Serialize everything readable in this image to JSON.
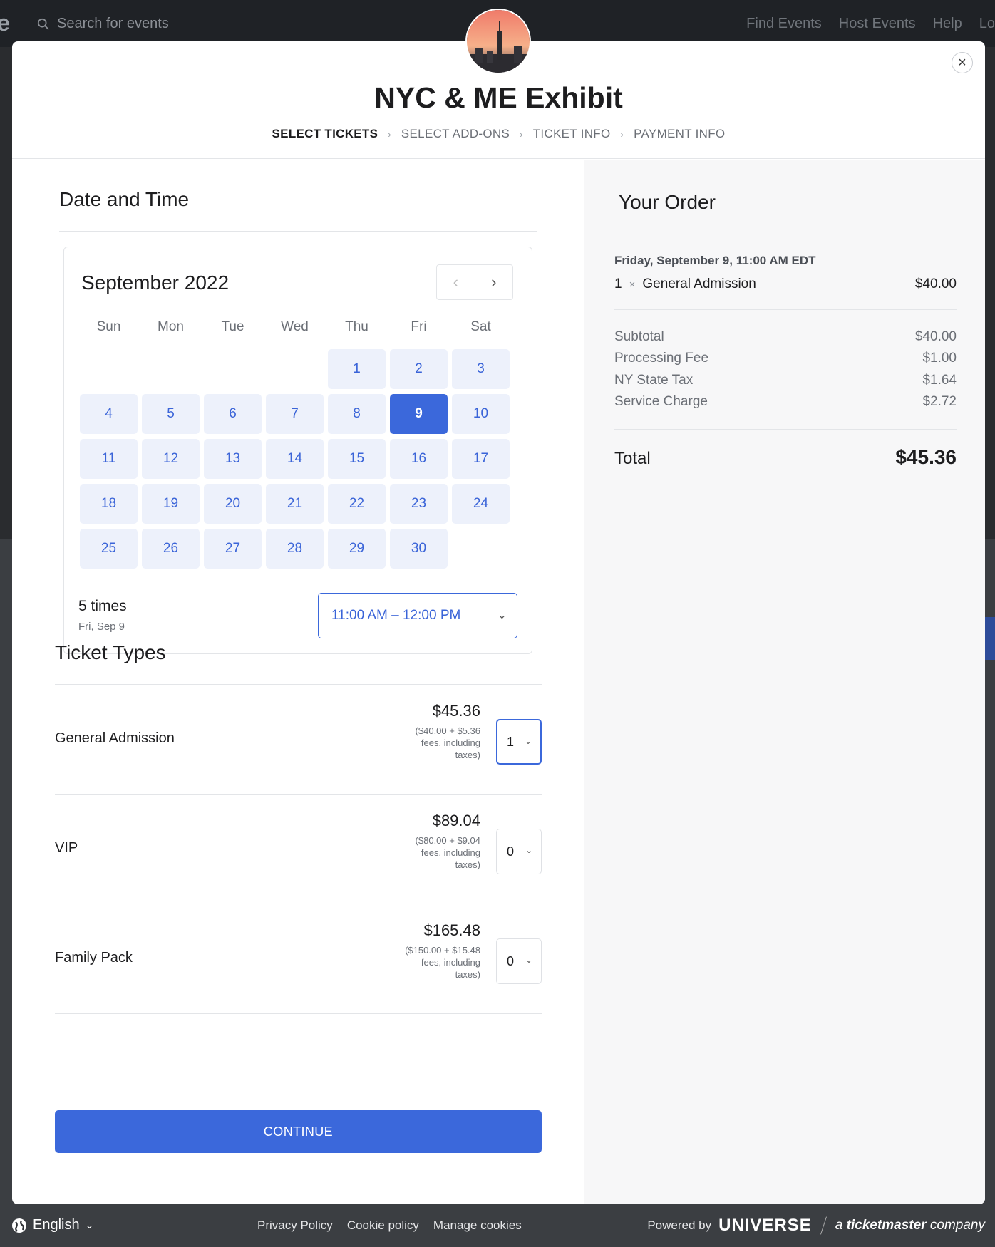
{
  "background": {
    "search_placeholder": "Search for events",
    "nav": [
      "Find Events",
      "Host Events",
      "Help",
      "Lo"
    ]
  },
  "modal": {
    "title": "NYC & ME Exhibit",
    "close_glyph": "×",
    "steps": [
      {
        "label": "SELECT TICKETS",
        "active": true
      },
      {
        "label": "SELECT ADD-ONS",
        "active": false
      },
      {
        "label": "TICKET INFO",
        "active": false
      },
      {
        "label": "PAYMENT INFO",
        "active": false
      }
    ]
  },
  "date_time": {
    "title": "Date and Time",
    "month": "September 2022",
    "prev_glyph": "‹",
    "next_glyph": "›",
    "weekdays": [
      "Sun",
      "Mon",
      "Tue",
      "Wed",
      "Thu",
      "Fri",
      "Sat"
    ],
    "first_weekday_index": 4,
    "days_in_month": 30,
    "selected_day": 9,
    "times_count": "5 times",
    "times_date": "Fri, Sep 9",
    "time_selected": "11:00 AM – 12:00 PM"
  },
  "tickets": {
    "title": "Ticket Types",
    "items": [
      {
        "name": "General Admission",
        "price": "$45.36",
        "fee": "($40.00 + $5.36 fees, including taxes)",
        "qty": "1"
      },
      {
        "name": "VIP",
        "price": "$89.04",
        "fee": "($80.00 + $9.04 fees, including taxes)",
        "qty": "0"
      },
      {
        "name": "Family Pack",
        "price": "$165.48",
        "fee": "($150.00 + $15.48 fees, including taxes)",
        "qty": "0"
      }
    ],
    "continue_label": "CONTINUE"
  },
  "order": {
    "title": "Your Order",
    "date": "Friday, September 9, 11:00 AM EDT",
    "line_qty": "1",
    "line_x": "×",
    "line_name": "General Admission",
    "line_price": "$40.00",
    "fees": [
      {
        "label": "Subtotal",
        "value": "$40.00"
      },
      {
        "label": "Processing Fee",
        "value": "$1.00"
      },
      {
        "label": "NY State Tax",
        "value": "$1.64"
      },
      {
        "label": "Service Charge",
        "value": "$2.72"
      }
    ],
    "total_label": "Total",
    "total_value": "$45.36"
  },
  "footer": {
    "language": "English",
    "links": [
      "Privacy Policy",
      "Cookie policy",
      "Manage cookies"
    ],
    "powered_by": "Powered by",
    "brand": "UNIVERSE",
    "company_prefix": "a",
    "company": "ticketmaster",
    "company_suffix": "company"
  },
  "colors": {
    "accent": "#3b68db",
    "day_bg": "#edf1fb",
    "summary_bg": "#f7f7f8"
  }
}
